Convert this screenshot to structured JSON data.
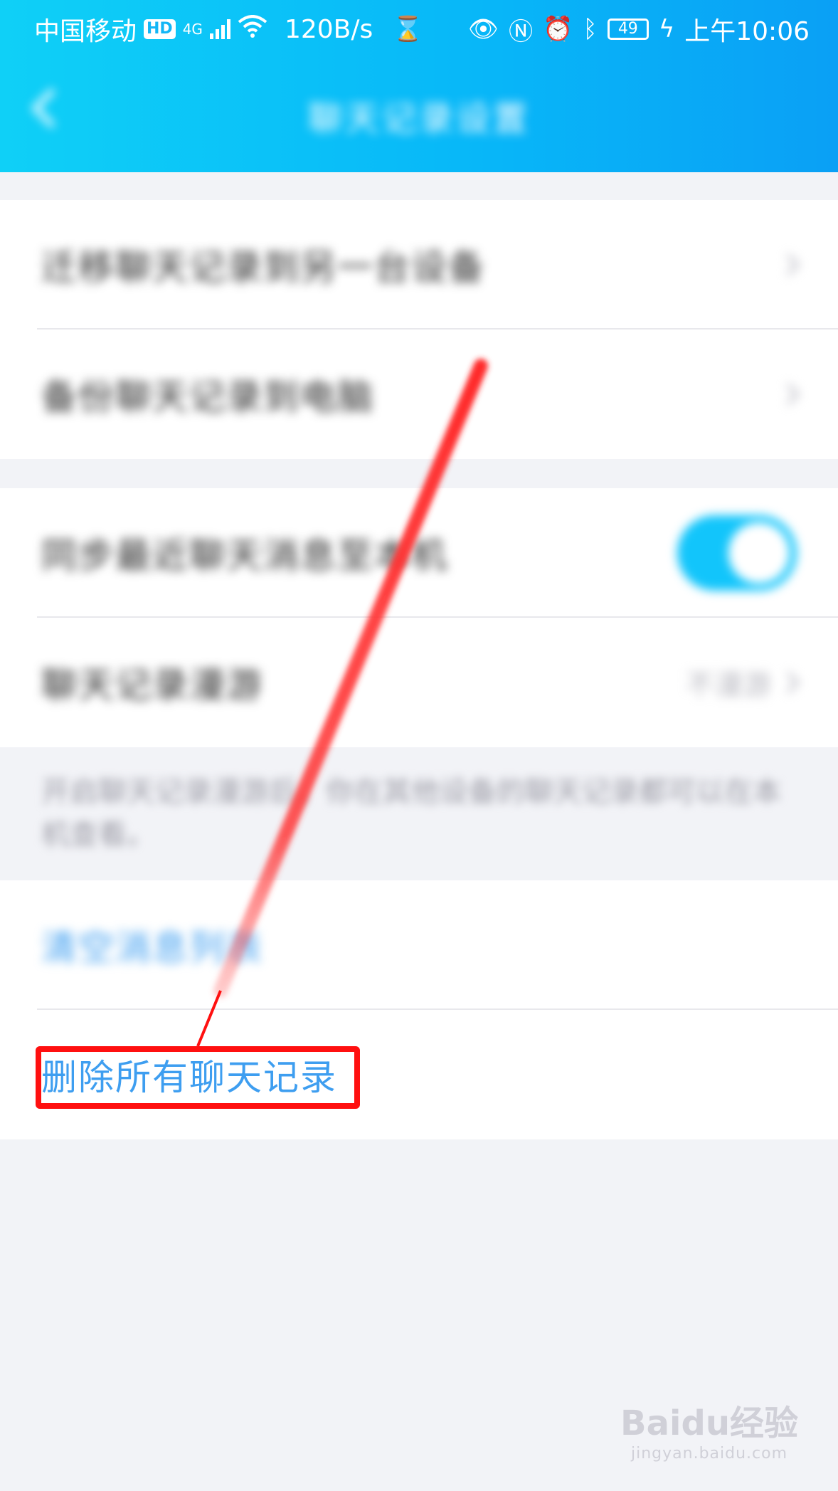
{
  "status_bar": {
    "carrier": "中国移动",
    "hd_badge": "HD",
    "network_type": "4G",
    "net_speed": "120B/s",
    "battery_level": "49",
    "time": "上午10:06"
  },
  "nav": {
    "title": "聊天记录设置"
  },
  "group1": {
    "items": [
      {
        "label": "迁移聊天记录到另一台设备"
      },
      {
        "label": "备份聊天记录到电脑"
      }
    ]
  },
  "group2": {
    "items": [
      {
        "label": "同步最近聊天消息至本机",
        "toggle_on": true
      },
      {
        "label": "聊天记录漫游",
        "value": "不漫游"
      }
    ]
  },
  "note": {
    "text": "开启聊天记录漫游后，你在其他设备的聊天记录都可以在本机查看。"
  },
  "group3": {
    "clear_messages": "清空消息列表",
    "delete_all": "删除所有聊天记录"
  },
  "watermark": {
    "logo": "Baidu经验",
    "url": "jingyan.baidu.com"
  },
  "colors": {
    "header_gradient_start": "#0fd0f7",
    "header_gradient_end": "#0aa0f5",
    "link_blue": "#3e9ef0",
    "toggle_on": "#12c5fb",
    "annotation_red": "#ff1010",
    "page_background": "#f2f3f7"
  }
}
